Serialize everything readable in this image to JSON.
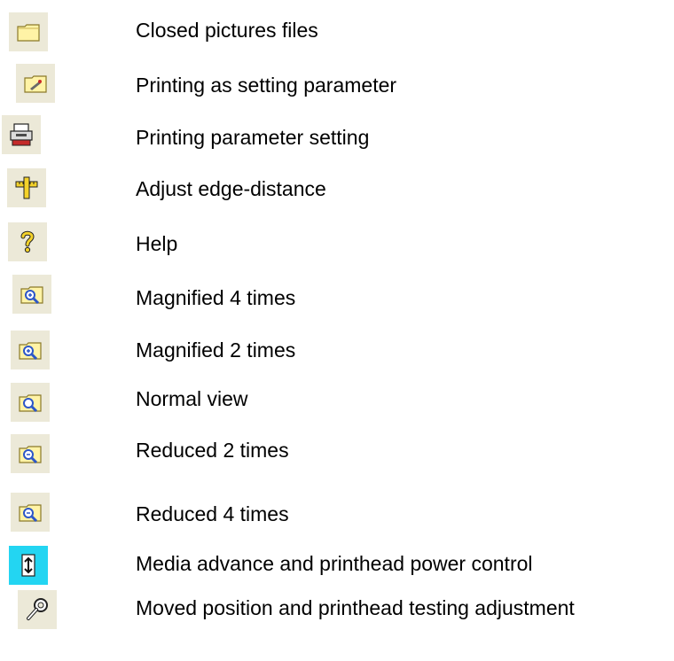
{
  "legend": [
    {
      "icon": "closed-folder-icon",
      "label": "Closed pictures files"
    },
    {
      "icon": "folder-print-settings-icon",
      "label": "Printing as setting parameter"
    },
    {
      "icon": "printer-parameter-icon",
      "label": "Printing parameter setting"
    },
    {
      "icon": "ruler-edge-distance-icon",
      "label": "Adjust edge-distance"
    },
    {
      "icon": "help-question-icon",
      "label": "Help"
    },
    {
      "icon": "zoom-in-folder-icon",
      "label": "Magnified 4 times"
    },
    {
      "icon": "zoom-in-folder-icon",
      "label": "Magnified 2 times"
    },
    {
      "icon": "normal-view-magnifier-icon",
      "label": "Normal view"
    },
    {
      "icon": "zoom-out-folder-icon",
      "label": "Reduced 2 times"
    },
    {
      "icon": "zoom-out-folder-icon",
      "label": "Reduced 4 times"
    },
    {
      "icon": "media-advance-icon",
      "label": "Media advance and printhead power control"
    },
    {
      "icon": "wrench-adjust-icon",
      "label": "Moved position and printhead testing adjustment"
    }
  ],
  "colors": {
    "icon_bg": "#ece9d8",
    "folder_yellow": "#fff3a6",
    "folder_stroke": "#8a7a2a",
    "magnifier_blue": "#2d57c8",
    "help_yellow": "#f4d22a",
    "media_cyan": "#23d5f2"
  }
}
